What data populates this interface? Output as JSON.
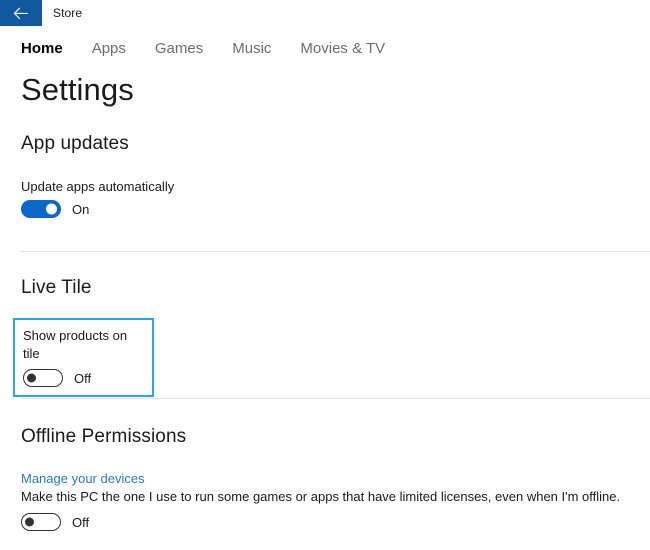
{
  "titlebar": {
    "back_icon": "back-arrow-icon",
    "app_title": "Store",
    "accent_color": "#12589e"
  },
  "nav": {
    "tabs": [
      {
        "label": "Home",
        "active": true
      },
      {
        "label": "Apps",
        "active": false
      },
      {
        "label": "Games",
        "active": false
      },
      {
        "label": "Music",
        "active": false
      },
      {
        "label": "Movies & TV",
        "active": false
      }
    ]
  },
  "page": {
    "title": "Settings"
  },
  "sections": {
    "app_updates": {
      "heading": "App updates",
      "setting_label": "Update apps automatically",
      "toggle_state": "On",
      "toggle_on": true
    },
    "live_tile": {
      "heading": "Live Tile",
      "setting_label": "Show products on tile",
      "toggle_state": "Off",
      "toggle_on": false,
      "focused": true,
      "focus_color": "#29a8e0"
    },
    "offline_permissions": {
      "heading": "Offline Permissions",
      "link_label": "Manage your devices",
      "link_color": "#2a7ac0",
      "description": "Make this PC the one I use to run some games or apps that have limited licenses, even when I'm offline.",
      "toggle_state": "Off",
      "toggle_on": false
    }
  }
}
